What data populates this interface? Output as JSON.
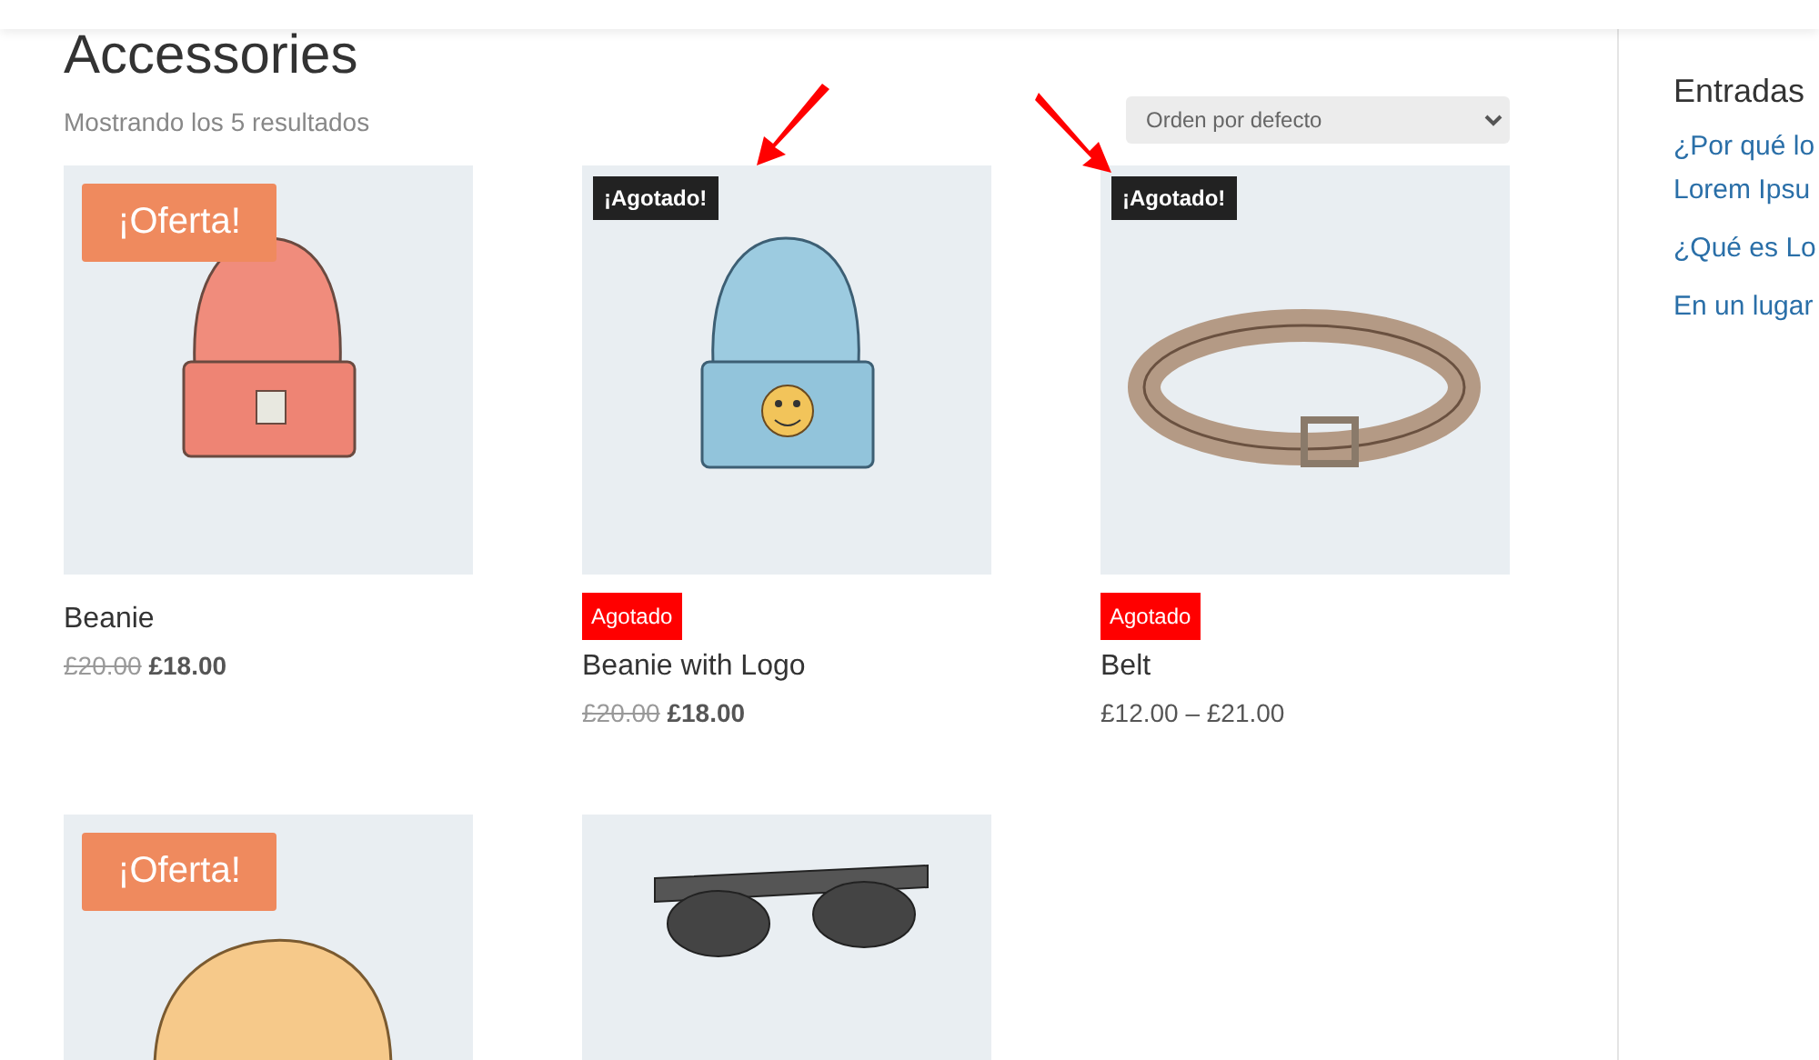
{
  "page": {
    "title": "Accessories",
    "result_count": "Mostrando los 5 resultados"
  },
  "sort": {
    "value": "Orden por defecto"
  },
  "products": [
    {
      "picture": {
        "kind": "beanie"
      },
      "sale_badge": {
        "kind": "oferta",
        "text": "¡Oferta!"
      },
      "name": "Beanie",
      "old_price": "£20.00",
      "price": "£18.00"
    },
    {
      "picture": {
        "kind": "beanie-logo"
      },
      "sale_badge": {
        "kind": "agotado",
        "text": "¡Agotado!"
      },
      "stock_label": "Agotado",
      "name": "Beanie with Logo",
      "old_price": "£20.00",
      "price": "£18.00",
      "arrow": {
        "kind": "down-left"
      }
    },
    {
      "picture": {
        "kind": "belt"
      },
      "sale_badge": {
        "kind": "agotado",
        "text": "¡Agotado!"
      },
      "stock_label": "Agotado",
      "name": "Belt",
      "price": "£12.00 – £21.00",
      "arrow": {
        "kind": "down-right"
      }
    },
    {
      "picture": {
        "kind": "cap"
      },
      "sale_badge": {
        "kind": "oferta",
        "text": "¡Oferta!"
      }
    },
    {
      "picture": {
        "kind": "sunglasses"
      }
    }
  ],
  "sidebar": {
    "heading": "Entradas",
    "posts": [
      {
        "lines": [
          "¿Por qué lo",
          "Lorem Ipsu"
        ]
      },
      {
        "lines": [
          "¿Qué es Lo"
        ]
      },
      {
        "lines": [
          "En un lugar"
        ]
      }
    ]
  }
}
